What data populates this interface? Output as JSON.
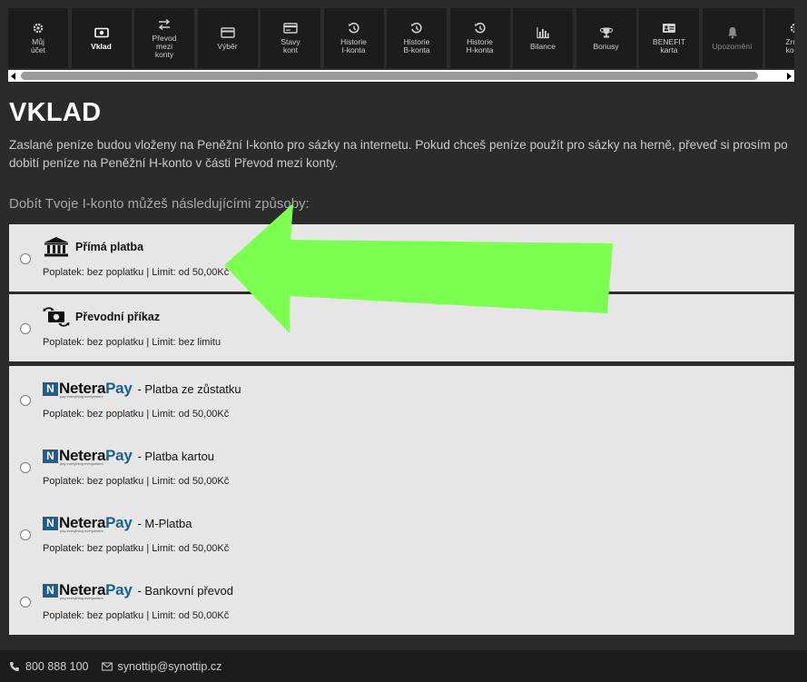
{
  "nav": {
    "items": [
      {
        "label_lines": [
          "Můj",
          "účet"
        ],
        "icon": "gear-icon",
        "state": "normal"
      },
      {
        "label_lines": [
          "Vklad"
        ],
        "icon": "cash-icon",
        "state": "active"
      },
      {
        "label_lines": [
          "Převod",
          "mezi",
          "konty"
        ],
        "icon": "transfer-icon",
        "state": "normal"
      },
      {
        "label_lines": [
          "Výběr"
        ],
        "icon": "card-icon",
        "state": "normal"
      },
      {
        "label_lines": [
          "Stavy",
          "kont"
        ],
        "icon": "wallet-icon",
        "state": "normal"
      },
      {
        "label_lines": [
          "Historie",
          "I-konta"
        ],
        "icon": "history-icon",
        "state": "normal"
      },
      {
        "label_lines": [
          "Historie",
          "B-konta"
        ],
        "icon": "history-icon",
        "state": "normal"
      },
      {
        "label_lines": [
          "Historie",
          "H-konta"
        ],
        "icon": "history-icon",
        "state": "normal"
      },
      {
        "label_lines": [
          "Bilance"
        ],
        "icon": "bar-chart-icon",
        "state": "normal"
      },
      {
        "label_lines": [
          "Bonusy"
        ],
        "icon": "trophy-icon",
        "state": "normal"
      },
      {
        "label_lines": [
          "BENEFIT",
          "karta"
        ],
        "icon": "id-card-icon",
        "state": "normal"
      },
      {
        "label_lines": [
          "Upozornění"
        ],
        "icon": "bell-icon",
        "state": "muted"
      },
      {
        "label_lines": [
          "Zrušit",
          "konto"
        ],
        "icon": "gear-icon",
        "state": "normal"
      }
    ]
  },
  "page": {
    "title": "VKLAD",
    "intro": "Zaslané peníze budou vloženy na Peněžní I-konto pro sázky na internetu. Pokud chceš peníze použít pro sázky na herně, převeď si prosím po dobití peníze na Peněžní H-konto v části Převod mezi konty.",
    "subhead": "Dobít Tvoje I-konto můžeš následujícími způsoby:"
  },
  "options": [
    {
      "type": "plain",
      "icon": "bank-icon",
      "title": "Přímá platba",
      "subtitle": "Poplatek: bez poplatku | Limit: od 50,00Kč"
    },
    {
      "type": "plain",
      "icon": "money-transfer-icon",
      "title": "Převodní příkaz",
      "subtitle": "Poplatek: bez poplatku | Limit: bez limitu"
    },
    {
      "type": "netera",
      "icon": "neterapay-logo",
      "title": "- Platba ze zůstatku",
      "subtitle": "Poplatek: bez poplatku | Limit: od 50,00Kč"
    },
    {
      "type": "netera",
      "icon": "neterapay-logo",
      "title": "- Platba kartou",
      "subtitle": "Poplatek: bez poplatku | Limit: od 50,00Kč"
    },
    {
      "type": "netera",
      "icon": "neterapay-logo",
      "title": "- M-Platba",
      "subtitle": "Poplatek: bez poplatku | Limit: od 50,00Kč"
    },
    {
      "type": "netera",
      "icon": "neterapay-logo",
      "title": "- Bankovní převod",
      "subtitle": "Poplatek: bez poplatku | Limit: od 50,00Kč"
    }
  ],
  "netera_logo": {
    "n": "N",
    "word1": "Netera",
    "word2": "Pay",
    "tagline": "pay everything everywhere"
  },
  "footer": {
    "phone": "800 888 100",
    "email": "synottip@synottip.cz"
  },
  "colors": {
    "background": "#2b2b2b",
    "nav_bg": "#1c1c1c",
    "option_bg": "#e6e6e6",
    "arrow": "#7dff52",
    "netera_blue": "#1e5e8c"
  }
}
